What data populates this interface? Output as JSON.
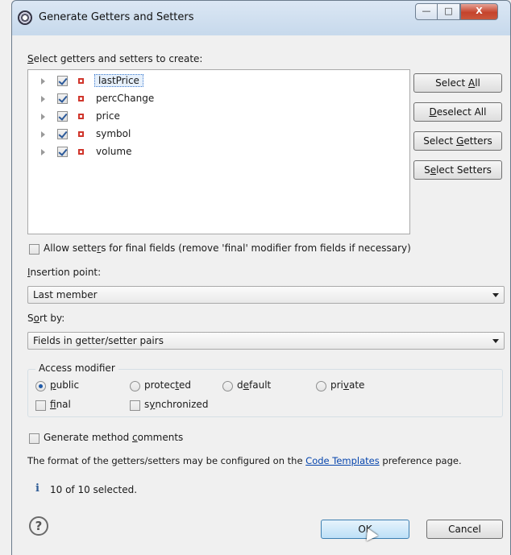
{
  "window": {
    "title": "Generate Getters and Setters",
    "buttons": {
      "minimize": "—",
      "maximize": "□",
      "close": "X"
    }
  },
  "section_label": {
    "pre": "",
    "mnemonic": "S",
    "post": "elect getters and setters to create:"
  },
  "fields": [
    {
      "name": "lastPrice",
      "checked": true,
      "selected": true
    },
    {
      "name": "percChange",
      "checked": true,
      "selected": false
    },
    {
      "name": "price",
      "checked": true,
      "selected": false
    },
    {
      "name": "symbol",
      "checked": true,
      "selected": false
    },
    {
      "name": "volume",
      "checked": true,
      "selected": false
    }
  ],
  "side_buttons": {
    "select_all": {
      "pre": "Select ",
      "mnemonic": "A",
      "post": "ll"
    },
    "deselect_all": {
      "pre": "",
      "mnemonic": "D",
      "post": "eselect All"
    },
    "select_getters": {
      "pre": "Select ",
      "mnemonic": "G",
      "post": "etters"
    },
    "select_setters": {
      "pre": "S",
      "mnemonic": "e",
      "post": "lect Setters"
    }
  },
  "allow_setters": {
    "pre": "Allow sette",
    "mnemonic": "r",
    "post": "s for final fields (remove 'final' modifier from fields if necessary)",
    "checked": false
  },
  "insertion_point": {
    "label_pre": "",
    "label_mnemonic": "I",
    "label_post": "nsertion point:",
    "value": "Last member"
  },
  "sort_by": {
    "label_pre": "S",
    "label_mnemonic": "o",
    "label_post": "rt by:",
    "value": "Fields in getter/setter pairs"
  },
  "access_modifier": {
    "legend": "Access modifier",
    "public": {
      "pre": "",
      "mnemonic": "p",
      "post": "ublic"
    },
    "protected": {
      "pre": "protec",
      "mnemonic": "t",
      "post": "ed"
    },
    "default": {
      "pre": "d",
      "mnemonic": "e",
      "post": "fault"
    },
    "private": {
      "pre": "pri",
      "mnemonic": "v",
      "post": "ate"
    },
    "selected": "public",
    "final": {
      "pre": "",
      "mnemonic": "f",
      "post": "inal"
    },
    "synchronized": {
      "pre": "s",
      "mnemonic": "y",
      "post": "nchronized"
    }
  },
  "generate_comments": {
    "pre": "Generate method ",
    "mnemonic": "c",
    "post": "omments",
    "checked": false
  },
  "templates_note": {
    "pre": "The format of the getters/setters may be configured on the ",
    "link": "Code Templates",
    "post": " preference page."
  },
  "status": {
    "icon": "info-icon",
    "text": "10 of 10 selected."
  },
  "footer": {
    "help_icon": "?",
    "ok": "OK",
    "cancel": "Cancel"
  }
}
